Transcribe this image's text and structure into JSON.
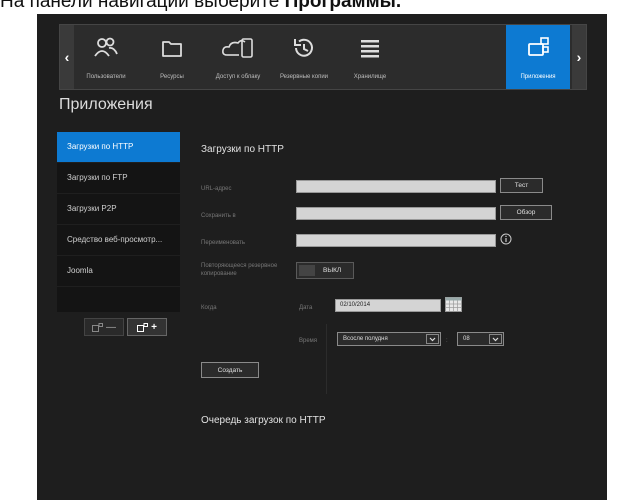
{
  "caption": {
    "text_prefix": "На панели навигации выберите ",
    "text_bold": "Программы."
  },
  "nav": {
    "items": [
      {
        "label": "Пользователи",
        "icon": "users-icon"
      },
      {
        "label": "Ресурсы",
        "icon": "folder-icon"
      },
      {
        "label": "Доступ к облаку",
        "icon": "cloud-devices-icon"
      },
      {
        "label": "Резервные копии",
        "icon": "history-icon"
      },
      {
        "label": "Хранилище",
        "icon": "storage-icon"
      },
      {
        "label": "Приложения",
        "icon": "apps-icon"
      }
    ],
    "active_index": 5,
    "prev_arrow": "‹",
    "next_arrow": "›"
  },
  "page_title": "Приложения",
  "sidebar": {
    "items": [
      "Загрузки по HTTP",
      "Загрузки по FTP",
      "Загрузки P2P",
      "Средство веб-просмотр...",
      "Joomla"
    ],
    "active_index": 0,
    "remove_symbol": "—",
    "add_symbol": "+"
  },
  "form": {
    "title": "Загрузки по HTTP",
    "url_label": "URL-адрес",
    "url_value": "",
    "test_button": "Тест",
    "save_to_label": "Сохранить в",
    "save_to_value": "",
    "browse_button": "Обзор",
    "rename_label": "Переименовать",
    "rename_value": "",
    "recurring_label": "Повторяющееся резервное копирование",
    "recurring_toggle": "ВЫКЛ",
    "when_label": "Когда",
    "date_label": "Дата",
    "date_value": "02/10/2014",
    "time_label": "Время",
    "ampm_value": "Всосле полудня",
    "hour_value": "08",
    "create_button": "Создать"
  },
  "queue_title": "Очередь загрузок по HTTP",
  "colors": {
    "accent": "#0d7ad2",
    "background": "#1e1e1e",
    "panel": "#141414"
  }
}
